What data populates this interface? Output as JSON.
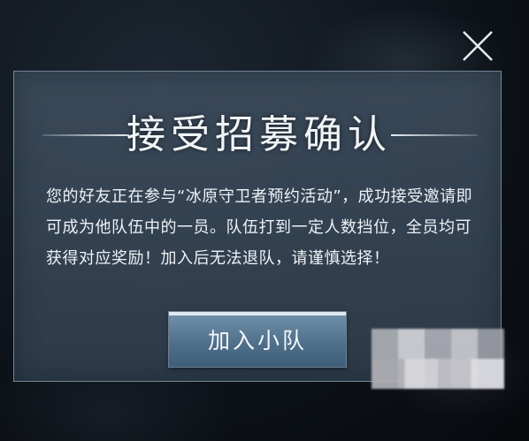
{
  "dialog": {
    "title": "接受招募确认",
    "message": "您的好友正在参与“冰原守卫者预约活动”，成功接受邀请即可成为他队伍中的一员。队伍打到一定人数挡位，全员均可获得对应奖励！加入后无法退队，请谨慎选择！",
    "join_button_label": "加入小队",
    "close_icon": "close-icon"
  },
  "colors": {
    "panel_background": "#3e4e5f",
    "panel_border": "#aabed2",
    "button_background": "#5a7b96",
    "text": "#eef2f6"
  }
}
